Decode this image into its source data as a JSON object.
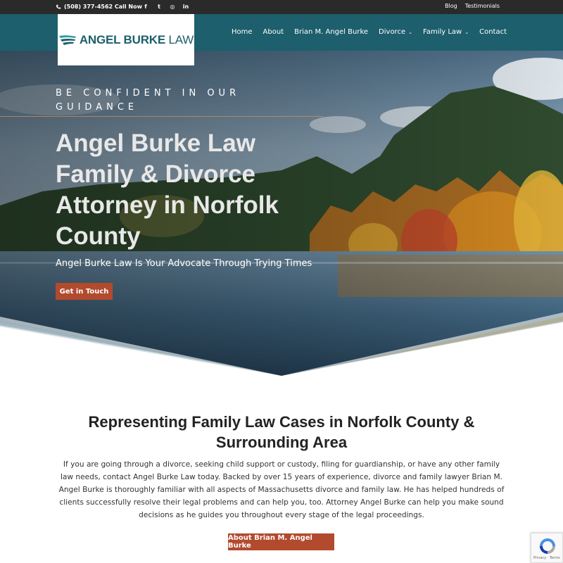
{
  "topbar": {
    "phone": "(508) 377-4562 Call Now",
    "phone_icon": "phone-icon",
    "social": [
      {
        "name": "facebook-icon",
        "glyph": "f"
      },
      {
        "name": "twitter-icon",
        "glyph": "t"
      },
      {
        "name": "instagram-icon",
        "glyph": "◎"
      },
      {
        "name": "linkedin-icon",
        "glyph": "in"
      }
    ],
    "links": [
      "Blog",
      "Testimonials"
    ]
  },
  "logo": {
    "bold": "ANGEL BURKE",
    "light": " LAW",
    "icon": "wing-logo-icon"
  },
  "nav": {
    "items": [
      {
        "label": "Home",
        "dropdown": false
      },
      {
        "label": "About",
        "dropdown": false
      },
      {
        "label": "Brian M. Angel Burke",
        "dropdown": false
      },
      {
        "label": "Divorce",
        "dropdown": true
      },
      {
        "label": "Family Law",
        "dropdown": true
      },
      {
        "label": "Contact",
        "dropdown": false
      }
    ]
  },
  "hero": {
    "eyebrow": "BE CONFIDENT IN OUR GUIDANCE",
    "title": "Angel Burke Law Family & Divorce Attorney in Norfolk County",
    "subtitle": "Angel Burke Law Is Your Advocate Through Trying Times",
    "button": "Get in Touch"
  },
  "main": {
    "title": "Representing Family Law Cases in Norfolk County & Surrounding Area",
    "body": "If you are going through a divorce, seeking child support or custody, filing for guardianship, or have any other family law needs, contact Angel Burke Law today. Backed by over 15 years of experience, divorce and family lawyer Brian M. Angel Burke is thoroughly familiar with all aspects of Massachusetts divorce and family law. He has helped hundreds of clients successfully resolve their legal problems and can help you, too. Attorney Angel Burke can help you make sound decisions as he guides you throughout every stage of the legal proceedings.",
    "button": "About Brian M. Angel Burke"
  },
  "recaptcha": {
    "terms": "Privacy · Terms",
    "icon": "recaptcha-icon"
  },
  "colors": {
    "teal": "#1d5f6c",
    "accent": "#b24a2e",
    "topbar": "#2a2a2a"
  }
}
